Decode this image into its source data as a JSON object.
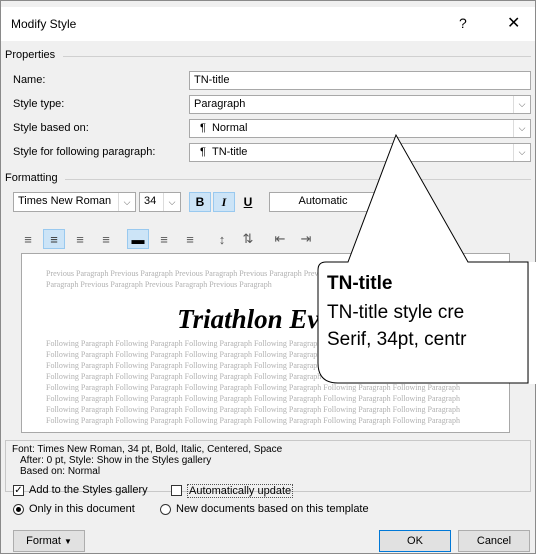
{
  "window": {
    "title": "Modify Style",
    "help_icon": "?",
    "close_icon": "✕"
  },
  "properties": {
    "group_label": "Properties",
    "name_label": "Name:",
    "name_value": "TN-title",
    "style_type_label": "Style type:",
    "style_type_value": "Paragraph",
    "based_on_label": "Style based on:",
    "based_on_value": "Normal",
    "following_label": "Style for following paragraph:",
    "following_value": "TN-title",
    "paragraph_mark": "¶"
  },
  "formatting": {
    "group_label": "Formatting",
    "font": "Times New Roman",
    "size": "34",
    "bold": "B",
    "italic": "I",
    "underline": "U",
    "color": "Automatic"
  },
  "preview": {
    "previous_text": "Previous Paragraph Previous Paragraph Previous Paragraph Previous Paragraph Previous Paragraph Previous Paragraph Previous Paragraph Previous Paragraph Previous Paragraph Previous Paragraph",
    "sample_text": "Triathlon Event",
    "following_text": "Following Paragraph Following Paragraph Following Paragraph Following Paragraph Following Paragraph Following Paragraph"
  },
  "description": {
    "line1": "Font: Times New Roman, 34 pt, Bold, Italic, Centered, Space",
    "line2": "After:  0 pt, Style: Show in the Styles gallery",
    "line3": "Based on: Normal"
  },
  "options": {
    "add_to_gallery": "Add to the Styles gallery",
    "add_to_gallery_checked": true,
    "auto_update": "Automatically update",
    "auto_update_checked": false,
    "only_this_document": "Only in this document",
    "new_documents": "New documents based on this template"
  },
  "buttons": {
    "format": "Format",
    "ok": "OK",
    "cancel": "Cancel"
  },
  "callout": {
    "title": "TN-title",
    "line1": "TN-title style cre",
    "line2": "Serif, 34pt, centr"
  }
}
